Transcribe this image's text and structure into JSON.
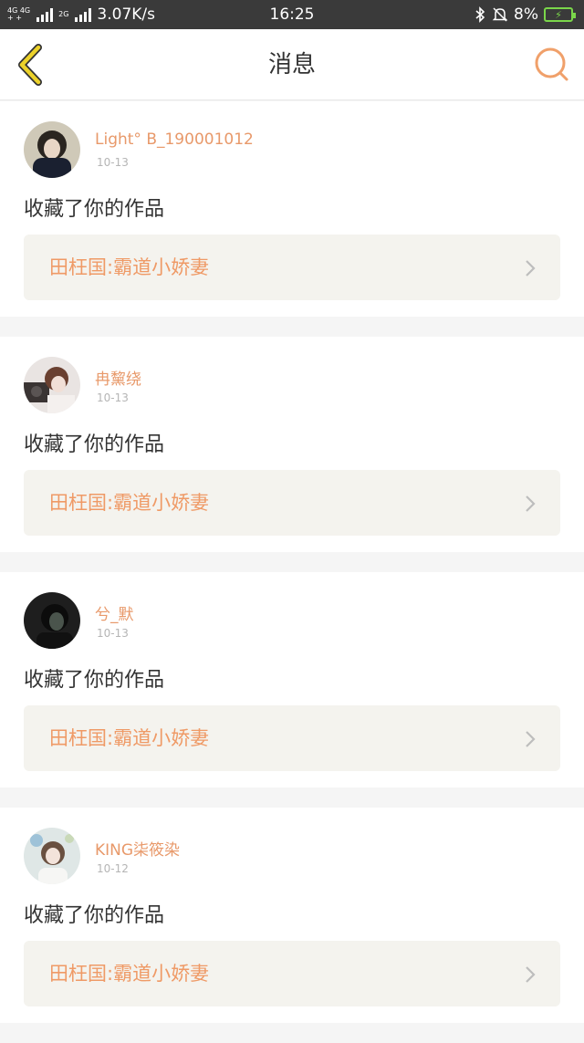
{
  "statusbar": {
    "network_top": "4G 4G",
    "network_bottom": "+ +",
    "network2": "2G",
    "speed": "3.07K/s",
    "time": "16:25",
    "battery": "8%",
    "icons": [
      "signal-icon",
      "bluetooth-icon",
      "bell-muted-icon",
      "battery-charging-icon"
    ]
  },
  "header": {
    "title": "消息",
    "back_icon": "chevron-left-icon",
    "search_icon": "search-icon"
  },
  "messages": [
    {
      "username": "Light° B_190001012",
      "date": "10-13",
      "action": "收藏了你的作品",
      "work": "田枉国:霸道小娇妻",
      "avatar": "dark-hair-avatar"
    },
    {
      "username": "冉黧绕",
      "date": "10-13",
      "action": "收藏了你的作品",
      "work": "田枉国:霸道小娇妻",
      "avatar": "camera-girl-avatar"
    },
    {
      "username": "兮_默",
      "date": "10-13",
      "action": "收藏了你的作品",
      "work": "田枉国:霸道小娇妻",
      "avatar": "moody-portrait-avatar"
    },
    {
      "username": "KING柒筱染",
      "date": "10-12",
      "action": "收藏了你的作品",
      "work": "田枉国:霸道小娇妻",
      "avatar": "flower-girl-avatar"
    }
  ],
  "colors": {
    "accent": "#e8996a",
    "statusbar": "#3a3a3a",
    "back_icon": "#e0c020",
    "link_bg": "#f4f3ee"
  }
}
